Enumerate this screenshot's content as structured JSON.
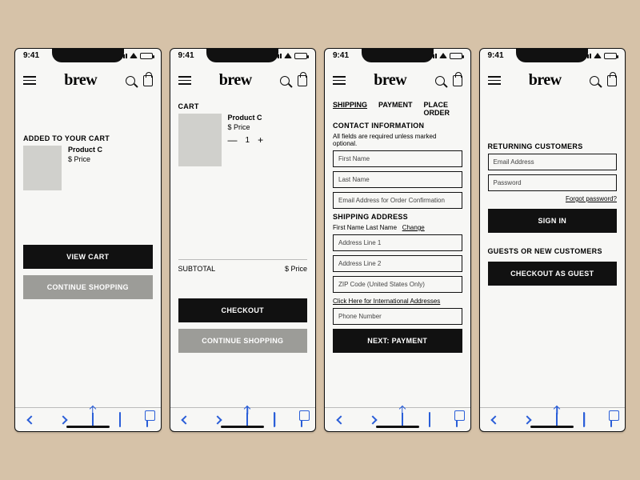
{
  "status": {
    "time": "9:41"
  },
  "brand": "brew",
  "screen1": {
    "title": "ADDED TO YOUR CART",
    "product_name": "Product C",
    "price": "$ Price",
    "view_cart": "VIEW CART",
    "continue": "CONTINUE SHOPPING"
  },
  "screen2": {
    "title": "CART",
    "product_name": "Product C",
    "price": "$ Price",
    "qty": "1",
    "subtotal_label": "SUBTOTAL",
    "subtotal_value": "$ Price",
    "checkout": "CHECKOUT",
    "continue": "CONTINUE SHOPPING"
  },
  "screen3": {
    "tabs": {
      "shipping": "SHIPPING",
      "payment": "PAYMENT",
      "place": "PLACE ORDER"
    },
    "contact_title": "CONTACT INFORMATION",
    "required_note": "All fields are required unless marked optional.",
    "first_name": "First Name",
    "last_name": "Last Name",
    "email": "Email Address for Order Confirmation",
    "shipping_title": "SHIPPING ADDRESS",
    "name_line": "First Name Last Name",
    "change": "Change",
    "addr1": "Address Line 1",
    "addr2": "Address Line 2",
    "zip": "ZIP Code (United States Only)",
    "intl_link": "Click Here for International Addresses",
    "phone": "Phone Number",
    "next": "NEXT: PAYMENT"
  },
  "screen4": {
    "returning_title": "RETURNING CUSTOMERS",
    "email": "Email Address",
    "password": "Password",
    "forgot": "Forgot password?",
    "signin": "SIGN IN",
    "guests_title": "GUESTS OR NEW CUSTOMERS",
    "guest_checkout": "CHECKOUT AS GUEST"
  }
}
